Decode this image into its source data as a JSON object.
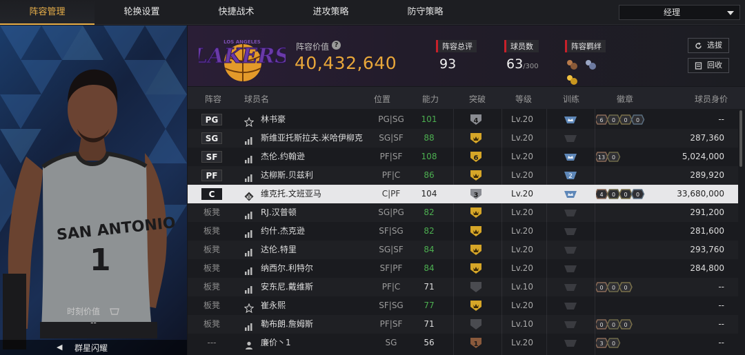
{
  "tabs": [
    {
      "label": "阵容管理",
      "active": true
    },
    {
      "label": "轮换设置"
    },
    {
      "label": "快捷战术"
    },
    {
      "label": "进攻策略"
    },
    {
      "label": "防守策略"
    }
  ],
  "role_select": {
    "value": "经理"
  },
  "player_card": {
    "jersey_team": "SAN ANTONIO",
    "jersey_number": "1",
    "moment_label": "时刻价值",
    "moment_value": "--",
    "card_name": "群星闪耀",
    "nav_prev": "◀"
  },
  "team": {
    "logo_text": "LAKERS",
    "logo_subtext": "LOS ANGELES",
    "value_label": "阵容价值",
    "value_help": "?",
    "value": "40,432,640",
    "rating_label": "阵容总评",
    "rating": "93",
    "count_label": "球员数",
    "count": "63",
    "count_max": "/300",
    "bond_label": "阵容羁绊",
    "bonds": [
      "bond-a-icon",
      "bond-b-icon",
      "bond-c-icon"
    ],
    "select_btn": "选拔",
    "recycle_btn": "回收"
  },
  "columns": [
    "阵容",
    "球员名",
    "位置",
    "能力",
    "突破",
    "等级",
    "训练",
    "徽章",
    "球员身价"
  ],
  "colors": {
    "accent": "#e9b04a",
    "value": "#e9a73a",
    "green": "#4caf50",
    "red": "#c8202a",
    "gold": "#d6a628"
  },
  "rows": [
    {
      "slot": "PG",
      "icon": "star",
      "name": "林书豪",
      "pos": "PG|SG",
      "ability": "101",
      "green": true,
      "breakthrough": "4",
      "bt": "silver",
      "level": "Lv.20",
      "train": "crown",
      "badges": [
        "6",
        "0",
        "0",
        "0"
      ],
      "value": "--"
    },
    {
      "slot": "SG",
      "icon": "bars",
      "name": "斯维亚托斯拉夫.米哈伊柳克",
      "pos": "SG|SF",
      "ability": "88",
      "green": true,
      "breakthrough": "",
      "bt": "gold",
      "level": "Lv.20",
      "train": "none",
      "badges": [],
      "value": "287,360"
    },
    {
      "slot": "SF",
      "icon": "bars",
      "name": "杰伦.约翰逊",
      "pos": "PF|SF",
      "ability": "108",
      "green": true,
      "breakthrough": "6",
      "bt": "goldnum",
      "level": "Lv.20",
      "train": "crown",
      "badges": [
        "13",
        "0"
      ],
      "value": "5,024,000"
    },
    {
      "slot": "PF",
      "icon": "bars",
      "name": "达柳斯.贝兹利",
      "pos": "PF|C",
      "ability": "86",
      "green": true,
      "breakthrough": "",
      "bt": "gold",
      "level": "Lv.20",
      "train": "two",
      "badges": [],
      "value": "289,920"
    },
    {
      "slot": "C",
      "icon": "gem",
      "name": "维克托.文班亚马",
      "pos": "C|PF",
      "ability": "104",
      "green": false,
      "breakthrough": "3",
      "bt": "silver",
      "level": "Lv.20",
      "train": "crown",
      "badges": [
        "4",
        "0",
        "0",
        "0"
      ],
      "value": "33,680,000",
      "selected": true
    },
    {
      "slot": "板凳",
      "icon": "bars",
      "name": "RJ.汉普顿",
      "pos": "SG|PG",
      "ability": "82",
      "green": true,
      "breakthrough": "",
      "bt": "gold",
      "level": "Lv.20",
      "train": "none",
      "badges": [],
      "value": "291,200"
    },
    {
      "slot": "板凳",
      "icon": "bars",
      "name": "约什.杰克逊",
      "pos": "SF|SG",
      "ability": "82",
      "green": true,
      "breakthrough": "",
      "bt": "gold",
      "level": "Lv.20",
      "train": "none",
      "badges": [],
      "value": "281,600"
    },
    {
      "slot": "板凳",
      "icon": "bars",
      "name": "达伦.特里",
      "pos": "SG|SF",
      "ability": "84",
      "green": true,
      "breakthrough": "",
      "bt": "gold",
      "level": "Lv.20",
      "train": "none",
      "badges": [],
      "value": "293,760"
    },
    {
      "slot": "板凳",
      "icon": "bars",
      "name": "纳西尔.利特尔",
      "pos": "SF|PF",
      "ability": "84",
      "green": true,
      "breakthrough": "",
      "bt": "gold",
      "level": "Lv.20",
      "train": "none",
      "badges": [],
      "value": "284,800"
    },
    {
      "slot": "板凳",
      "icon": "bars",
      "name": "安东尼.戴维斯",
      "pos": "PF|C",
      "ability": "71",
      "green": false,
      "breakthrough": "",
      "bt": "gray",
      "level": "Lv.10",
      "train": "none",
      "badges": [
        "0",
        "0",
        "0"
      ],
      "value": "--"
    },
    {
      "slot": "板凳",
      "icon": "star",
      "name": "崔永熙",
      "pos": "SF|SG",
      "ability": "77",
      "green": true,
      "breakthrough": "",
      "bt": "gold",
      "level": "Lv.20",
      "train": "none",
      "badges": [],
      "value": "--"
    },
    {
      "slot": "板凳",
      "icon": "bars",
      "name": "勒布朗.詹姆斯",
      "pos": "PF|SF",
      "ability": "71",
      "green": false,
      "breakthrough": "",
      "bt": "gray",
      "level": "Lv.10",
      "train": "none",
      "badges": [
        "0",
        "0",
        "0"
      ],
      "value": "--"
    },
    {
      "slot": "---",
      "icon": "person",
      "name": "廉价丶1",
      "pos": "SG",
      "ability": "56",
      "green": false,
      "breakthrough": "1",
      "bt": "bronze",
      "level": "Lv.20",
      "train": "none",
      "badges": [
        "3",
        "0"
      ],
      "value": "--"
    }
  ]
}
